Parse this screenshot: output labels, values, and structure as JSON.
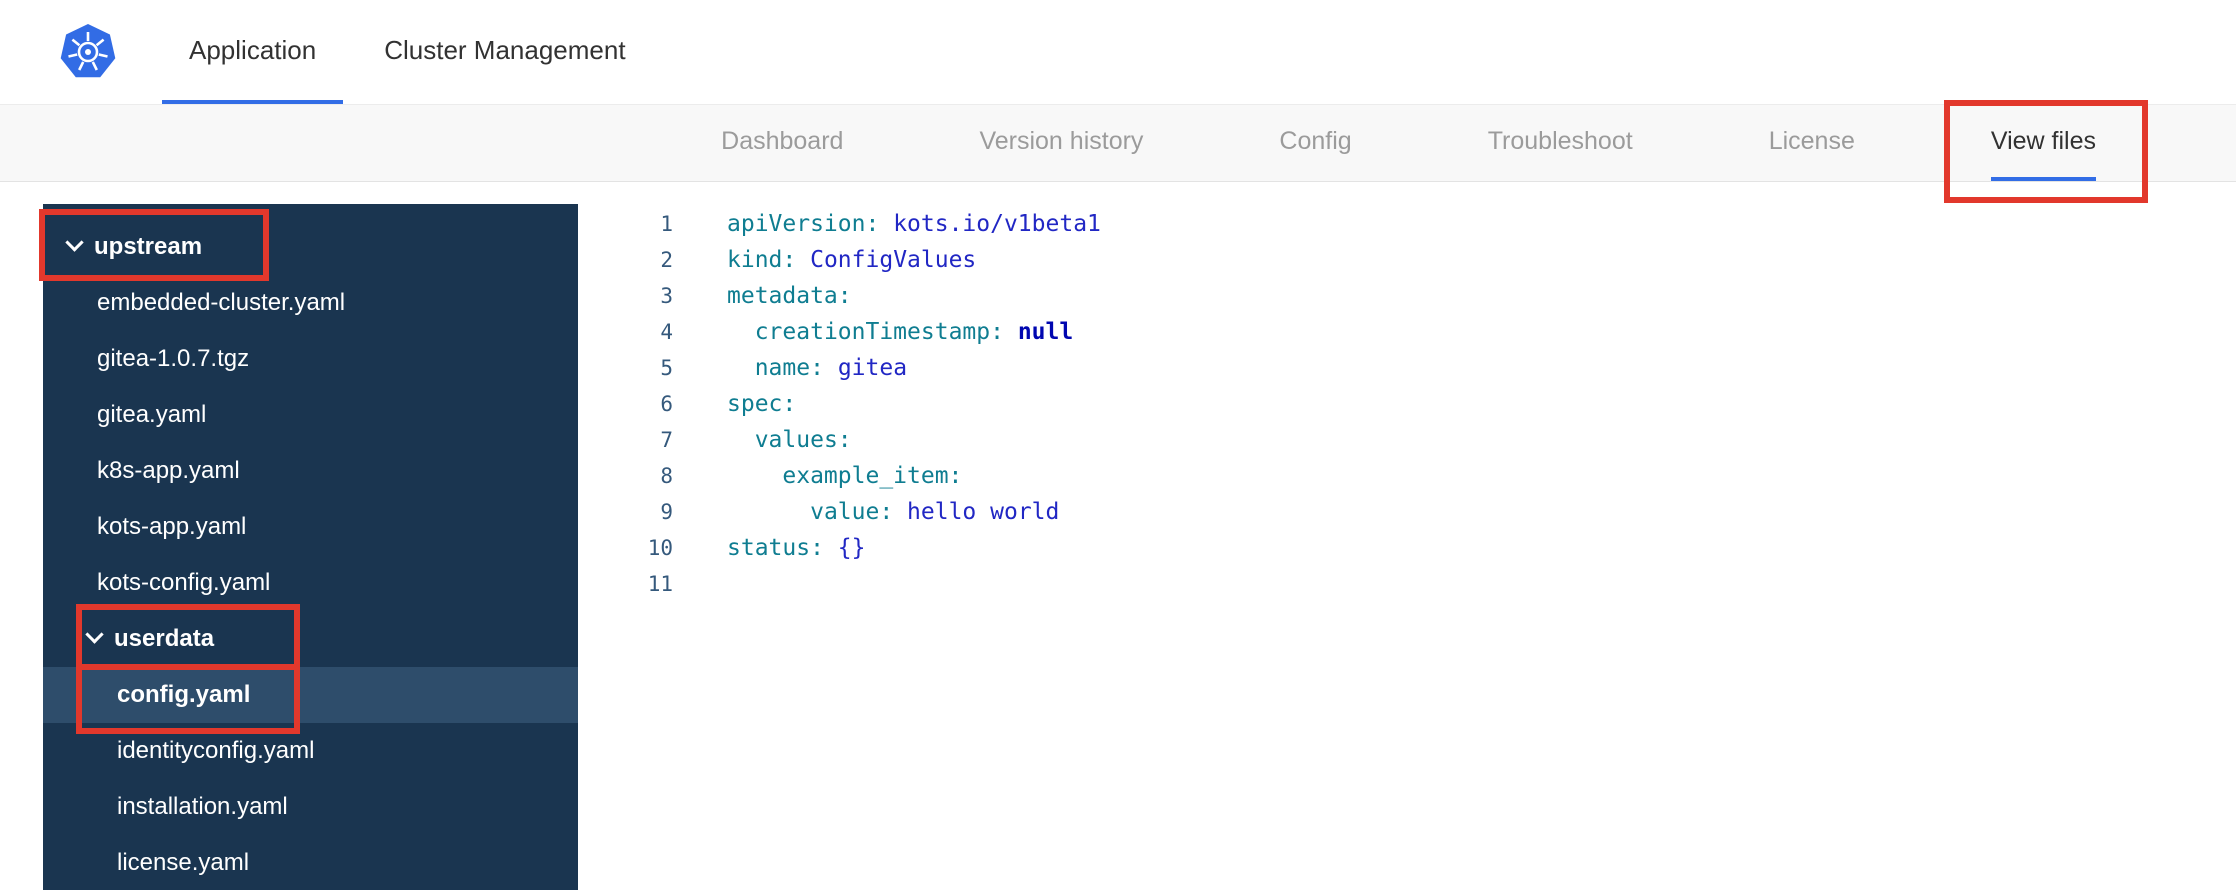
{
  "header": {
    "logo": "kubernetes-logo",
    "tabs": [
      {
        "label": "Application",
        "active": true
      },
      {
        "label": "Cluster Management",
        "active": false
      }
    ]
  },
  "subnav": {
    "tabs": [
      {
        "label": "Dashboard",
        "active": false,
        "annotated": false
      },
      {
        "label": "Version history",
        "active": false,
        "annotated": false
      },
      {
        "label": "Config",
        "active": false,
        "annotated": false
      },
      {
        "label": "Troubleshoot",
        "active": false,
        "annotated": false
      },
      {
        "label": "License",
        "active": false,
        "annotated": false
      },
      {
        "label": "View files",
        "active": true,
        "annotated": true
      }
    ]
  },
  "file_tree": {
    "items": [
      {
        "label": "upstream",
        "type": "folder",
        "depth": 0,
        "expanded": true,
        "selected": false,
        "annotated": true
      },
      {
        "label": "embedded-cluster.yaml",
        "type": "file",
        "depth": 1,
        "selected": false,
        "annotated": false
      },
      {
        "label": "gitea-1.0.7.tgz",
        "type": "file",
        "depth": 1,
        "selected": false,
        "annotated": false
      },
      {
        "label": "gitea.yaml",
        "type": "file",
        "depth": 1,
        "selected": false,
        "annotated": false
      },
      {
        "label": "k8s-app.yaml",
        "type": "file",
        "depth": 1,
        "selected": false,
        "annotated": false
      },
      {
        "label": "kots-app.yaml",
        "type": "file",
        "depth": 1,
        "selected": false,
        "annotated": false
      },
      {
        "label": "kots-config.yaml",
        "type": "file",
        "depth": 1,
        "selected": false,
        "annotated": false
      },
      {
        "label": "userdata",
        "type": "folder",
        "depth": 1,
        "expanded": true,
        "selected": false,
        "annotated": true
      },
      {
        "label": "config.yaml",
        "type": "file",
        "depth": 2,
        "selected": true,
        "annotated": true
      },
      {
        "label": "identityconfig.yaml",
        "type": "file",
        "depth": 2,
        "selected": false,
        "annotated": false
      },
      {
        "label": "installation.yaml",
        "type": "file",
        "depth": 2,
        "selected": false,
        "annotated": false
      },
      {
        "label": "license.yaml",
        "type": "file",
        "depth": 2,
        "selected": false,
        "annotated": false
      }
    ]
  },
  "editor": {
    "lines": [
      {
        "num": 1,
        "tokens": [
          {
            "c": "key",
            "t": "apiVersion:"
          },
          {
            "c": "plain",
            "t": " "
          },
          {
            "c": "val",
            "t": "kots.io/v1beta1"
          }
        ]
      },
      {
        "num": 2,
        "tokens": [
          {
            "c": "key",
            "t": "kind:"
          },
          {
            "c": "plain",
            "t": " "
          },
          {
            "c": "val",
            "t": "ConfigValues"
          }
        ]
      },
      {
        "num": 3,
        "tokens": [
          {
            "c": "key",
            "t": "metadata:"
          }
        ]
      },
      {
        "num": 4,
        "tokens": [
          {
            "c": "plain",
            "t": "  "
          },
          {
            "c": "key",
            "t": "creationTimestamp:"
          },
          {
            "c": "plain",
            "t": " "
          },
          {
            "c": "null",
            "t": "null"
          }
        ]
      },
      {
        "num": 5,
        "tokens": [
          {
            "c": "plain",
            "t": "  "
          },
          {
            "c": "key",
            "t": "name:"
          },
          {
            "c": "plain",
            "t": " "
          },
          {
            "c": "val",
            "t": "gitea"
          }
        ]
      },
      {
        "num": 6,
        "tokens": [
          {
            "c": "key",
            "t": "spec:"
          }
        ]
      },
      {
        "num": 7,
        "tokens": [
          {
            "c": "plain",
            "t": "  "
          },
          {
            "c": "key",
            "t": "values:"
          }
        ]
      },
      {
        "num": 8,
        "tokens": [
          {
            "c": "plain",
            "t": "    "
          },
          {
            "c": "key",
            "t": "example_item:"
          }
        ]
      },
      {
        "num": 9,
        "tokens": [
          {
            "c": "plain",
            "t": "      "
          },
          {
            "c": "key",
            "t": "value:"
          },
          {
            "c": "plain",
            "t": " "
          },
          {
            "c": "val",
            "t": "hello world"
          }
        ]
      },
      {
        "num": 10,
        "tokens": [
          {
            "c": "key",
            "t": "status:"
          },
          {
            "c": "plain",
            "t": " "
          },
          {
            "c": "val",
            "t": "{}"
          }
        ]
      },
      {
        "num": 11,
        "tokens": []
      }
    ]
  },
  "annotations": [
    {
      "target": "view-files-tab"
    },
    {
      "target": "upstream-folder"
    },
    {
      "target": "userdata-folder"
    },
    {
      "target": "config-yaml-file"
    }
  ],
  "colors": {
    "accent_blue": "#326de6",
    "annotation_red": "#e2382c",
    "sidebar_bg": "#1a3550",
    "sidebar_selected": "#2e4d6b",
    "code_key": "#0f7d91",
    "code_value": "#2127c4",
    "code_null": "#0007b0",
    "line_number": "#35597c"
  }
}
